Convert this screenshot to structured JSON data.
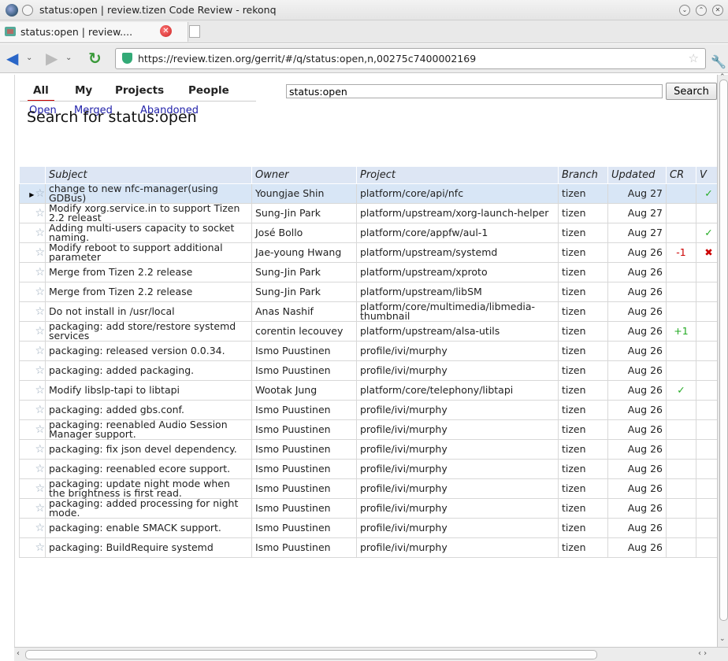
{
  "window": {
    "title": "status:open | review.tizen Code Review - rekonq"
  },
  "tab": {
    "label": "status:open | review...."
  },
  "navbar": {
    "url": "https://review.tizen.org/gerrit/#/q/status:open,n,00275c7400002169"
  },
  "menu": {
    "items": [
      {
        "label": "All",
        "selected": true
      },
      {
        "label": "My",
        "selected": false
      },
      {
        "label": "Projects",
        "selected": false
      },
      {
        "label": "People",
        "selected": false
      }
    ],
    "sub": [
      "Open",
      "Merged",
      "Abandoned"
    ]
  },
  "search": {
    "value": "status:open",
    "button": "Search"
  },
  "page": {
    "title": "Search for status:open"
  },
  "table": {
    "headers": {
      "subject": "Subject",
      "owner": "Owner",
      "project": "Project",
      "branch": "Branch",
      "updated": "Updated",
      "cr": "CR",
      "v": "V"
    },
    "rows": [
      {
        "subject": "change to new nfc-manager(using GDBus)",
        "owner": "Youngjae Shin",
        "project": "platform/core/api/nfc",
        "branch": "tizen",
        "updated": "Aug 27",
        "cr": "",
        "v": "✓",
        "selected": true
      },
      {
        "subject": "Modify xorg.service.in to support Tizen 2.2 releast",
        "owner": "Sung-Jin Park",
        "project": "platform/upstream/xorg-launch-helper",
        "branch": "tizen",
        "updated": "Aug 27",
        "cr": "",
        "v": ""
      },
      {
        "subject": "Adding multi-users capacity to socket naming.",
        "owner": "José Bollo",
        "project": "platform/core/appfw/aul-1",
        "branch": "tizen",
        "updated": "Aug 27",
        "cr": "",
        "v": "✓"
      },
      {
        "subject": "Modify reboot to support additional parameter",
        "owner": "Jae-young Hwang",
        "project": "platform/upstream/systemd",
        "branch": "tizen",
        "updated": "Aug 26",
        "cr": "-1",
        "v": "✖"
      },
      {
        "subject": "Merge from Tizen 2.2 release",
        "owner": "Sung-Jin Park",
        "project": "platform/upstream/xproto",
        "branch": "tizen",
        "updated": "Aug 26",
        "cr": "",
        "v": ""
      },
      {
        "subject": "Merge from Tizen 2.2 release",
        "owner": "Sung-Jin Park",
        "project": "platform/upstream/libSM",
        "branch": "tizen",
        "updated": "Aug 26",
        "cr": "",
        "v": ""
      },
      {
        "subject": "Do not install in /usr/local",
        "owner": "Anas Nashif",
        "project": "platform/core/multimedia/libmedia-thumbnail",
        "branch": "tizen",
        "updated": "Aug 26",
        "cr": "",
        "v": ""
      },
      {
        "subject": "packaging: add store/restore systemd services",
        "owner": "corentin lecouvey",
        "project": "platform/upstream/alsa-utils",
        "branch": "tizen",
        "updated": "Aug 26",
        "cr": "+1",
        "v": ""
      },
      {
        "subject": "packaging: released version 0.0.34.",
        "owner": "Ismo Puustinen",
        "project": "profile/ivi/murphy",
        "branch": "tizen",
        "updated": "Aug 26",
        "cr": "",
        "v": ""
      },
      {
        "subject": "packaging: added packaging.",
        "owner": "Ismo Puustinen",
        "project": "profile/ivi/murphy",
        "branch": "tizen",
        "updated": "Aug 26",
        "cr": "",
        "v": ""
      },
      {
        "subject": "Modify libslp-tapi to libtapi",
        "owner": "Wootak Jung",
        "project": "platform/core/telephony/libtapi",
        "branch": "tizen",
        "updated": "Aug 26",
        "cr": "✓",
        "v": ""
      },
      {
        "subject": "packaging: added gbs.conf.",
        "owner": "Ismo Puustinen",
        "project": "profile/ivi/murphy",
        "branch": "tizen",
        "updated": "Aug 26",
        "cr": "",
        "v": ""
      },
      {
        "subject": "packaging: reenabled Audio Session Manager support.",
        "owner": "Ismo Puustinen",
        "project": "profile/ivi/murphy",
        "branch": "tizen",
        "updated": "Aug 26",
        "cr": "",
        "v": ""
      },
      {
        "subject": "packaging: fix json devel dependency.",
        "owner": "Ismo Puustinen",
        "project": "profile/ivi/murphy",
        "branch": "tizen",
        "updated": "Aug 26",
        "cr": "",
        "v": ""
      },
      {
        "subject": "packaging: reenabled ecore support.",
        "owner": "Ismo Puustinen",
        "project": "profile/ivi/murphy",
        "branch": "tizen",
        "updated": "Aug 26",
        "cr": "",
        "v": ""
      },
      {
        "subject": "packaging: update night mode when the brightness is first read.",
        "owner": "Ismo Puustinen",
        "project": "profile/ivi/murphy",
        "branch": "tizen",
        "updated": "Aug 26",
        "cr": "",
        "v": ""
      },
      {
        "subject": "packaging: added processing for night mode.",
        "owner": "Ismo Puustinen",
        "project": "profile/ivi/murphy",
        "branch": "tizen",
        "updated": "Aug 26",
        "cr": "",
        "v": ""
      },
      {
        "subject": "packaging: enable SMACK support.",
        "owner": "Ismo Puustinen",
        "project": "profile/ivi/murphy",
        "branch": "tizen",
        "updated": "Aug 26",
        "cr": "",
        "v": ""
      },
      {
        "subject": "packaging: BuildRequire systemd",
        "owner": "Ismo Puustinen",
        "project": "profile/ivi/murphy",
        "branch": "tizen",
        "updated": "Aug 26",
        "cr": "",
        "v": ""
      }
    ]
  }
}
